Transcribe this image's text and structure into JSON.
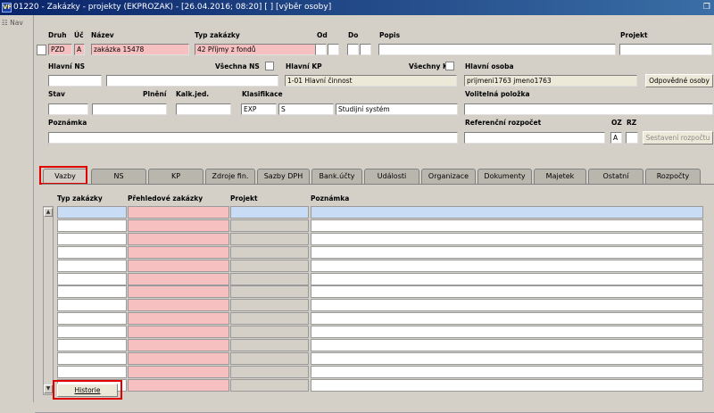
{
  "window": {
    "title": "01220 - Zakázky - projekty (EKPROZAK) - [26.04.2016; 08:20] [ ] [výběr osoby]",
    "logo": "VF",
    "restore_icon": "restore-icon"
  },
  "nav": {
    "label": "Nav"
  },
  "header": {
    "row1": {
      "druh_label": "Druh",
      "druh_value": "PZD",
      "uc_label": "Úč",
      "uc_value": "A",
      "nazev_label": "Název",
      "nazev_value": "zakázka 15478",
      "typ_label": "Typ zakázky",
      "typ_value": "42 Příjmy z fondů",
      "od_label": "Od",
      "do_label": "Do",
      "popis_label": "Popis",
      "popis_value": "",
      "projekt_label": "Projekt",
      "projekt_value": ""
    },
    "row2": {
      "hlavni_ns_label": "Hlavní NS",
      "hlavni_ns_value": "",
      "vsechna_ns_label": "Všechna NS",
      "hlavni_kp_label": "Hlavní KP",
      "hlavni_kp_value": "1-01 Hlavní činnost",
      "vsechny_kp_label": "Všechny KP",
      "hlavni_osoba_label": "Hlavní osoba",
      "hlavni_osoba_value": "prijmeni1763 jmeno1763",
      "odpovedne_osoby_button": "Odpovědné osoby"
    },
    "row3": {
      "stav_label": "Stav",
      "plneni_label": "Plnění",
      "kalk_label": "Kalk.jed.",
      "klasifikace_label": "Klasifikace",
      "klas_code": "EXP",
      "klas_sub": "S",
      "klas_name": "Studijní systém",
      "volitelna_label": "Volitelná položka"
    },
    "row4": {
      "poznamka_label": "Poznámka",
      "poznamka_value": "",
      "ref_rozpocet_label": "Referenční rozpočet",
      "oz_label": "OZ",
      "oz_value": "A",
      "rz_label": "RZ",
      "sestaveni_button": "Sestavení rozpočtu"
    }
  },
  "tabs": [
    {
      "label": "Vazby",
      "active": true
    },
    {
      "label": "NS"
    },
    {
      "label": "KP"
    },
    {
      "label": "Zdroje fin."
    },
    {
      "label": "Sazby DPH"
    },
    {
      "label": "Bank.účty"
    },
    {
      "label": "Události"
    },
    {
      "label": "Organizace"
    },
    {
      "label": "Dokumenty"
    },
    {
      "label": "Majetek"
    },
    {
      "label": "Ostatní"
    },
    {
      "label": "Rozpočty"
    }
  ],
  "grid": {
    "columns": [
      "Typ zakázky",
      "Přehledové zakázky",
      "Projekt",
      "Poznámka"
    ],
    "rows": 14,
    "scroll_up_icon": "scroll-up-icon",
    "scroll_down_icon": "scroll-down-icon"
  },
  "historie_button": "Historie",
  "colors": {
    "required": "#f7c0c0",
    "selected_row": "#c8dcf5",
    "highlight": "#e00000"
  }
}
